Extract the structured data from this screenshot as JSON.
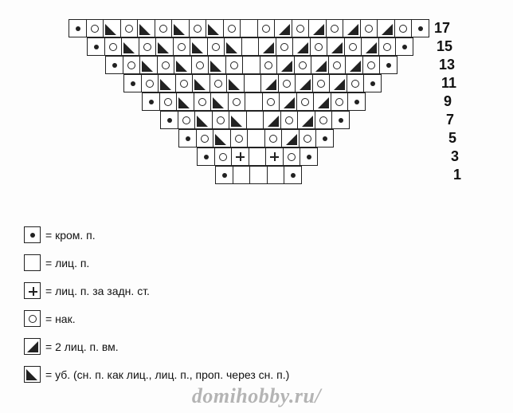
{
  "chart_data": {
    "type": "table",
    "title": "Knitting chart (triangular shawl), odd rows 1–17",
    "row_numbers": [
      17,
      15,
      13,
      11,
      9,
      7,
      5,
      3,
      1
    ],
    "symbols": {
      "dot": "кром. п.",
      "knit": "лиц. п.",
      "plus": "лиц. п. за задн. ст.",
      "yo": "нак.",
      "k2": "2 лиц. п. вм.",
      "ssk": "уб. (сн. п. как лиц., лиц. п., проп. через сн. п.)"
    },
    "rows": [
      {
        "label": 17,
        "cells": [
          "dot",
          "yo",
          "ssk",
          "yo",
          "ssk",
          "yo",
          "ssk",
          "yo",
          "ssk",
          "yo",
          "knit",
          "yo",
          "k2",
          "yo",
          "k2",
          "yo",
          "k2",
          "yo",
          "k2",
          "yo",
          "dot"
        ]
      },
      {
        "label": 15,
        "cells": [
          "dot",
          "yo",
          "ssk",
          "yo",
          "ssk",
          "yo",
          "ssk",
          "yo",
          "ssk",
          "knit",
          "k2",
          "yo",
          "k2",
          "yo",
          "k2",
          "yo",
          "k2",
          "yo",
          "dot"
        ]
      },
      {
        "label": 13,
        "cells": [
          "dot",
          "yo",
          "ssk",
          "yo",
          "ssk",
          "yo",
          "ssk",
          "yo",
          "knit",
          "yo",
          "k2",
          "yo",
          "k2",
          "yo",
          "k2",
          "yo",
          "dot"
        ]
      },
      {
        "label": 11,
        "cells": [
          "dot",
          "yo",
          "ssk",
          "yo",
          "ssk",
          "yo",
          "ssk",
          "knit",
          "k2",
          "yo",
          "k2",
          "yo",
          "k2",
          "yo",
          "dot"
        ]
      },
      {
        "label": 9,
        "cells": [
          "dot",
          "yo",
          "ssk",
          "yo",
          "ssk",
          "yo",
          "knit",
          "yo",
          "k2",
          "yo",
          "k2",
          "yo",
          "dot"
        ]
      },
      {
        "label": 7,
        "cells": [
          "dot",
          "yo",
          "ssk",
          "yo",
          "ssk",
          "knit",
          "k2",
          "yo",
          "k2",
          "yo",
          "dot"
        ]
      },
      {
        "label": 5,
        "cells": [
          "dot",
          "yo",
          "ssk",
          "yo",
          "knit",
          "yo",
          "k2",
          "yo",
          "dot"
        ]
      },
      {
        "label": 3,
        "cells": [
          "dot",
          "yo",
          "plus",
          "knit",
          "plus",
          "yo",
          "dot"
        ]
      },
      {
        "label": 1,
        "cells": [
          "dot",
          "knit",
          "knit",
          "knit",
          "dot"
        ]
      }
    ]
  },
  "legend": [
    {
      "sym": "dot",
      "txt": "= кром. п."
    },
    {
      "sym": "knit",
      "txt": "= лиц. п."
    },
    {
      "sym": "plus",
      "txt": "= лиц. п. за задн. ст."
    },
    {
      "sym": "yo",
      "txt": "= нак."
    },
    {
      "sym": "k2",
      "txt": "= 2 лиц. п. вм."
    },
    {
      "sym": "ssk",
      "txt": "= уб. (сн. п. как лиц., лиц. п., проп. через сн. п.)"
    }
  ],
  "watermark": "domihobby.ru/"
}
